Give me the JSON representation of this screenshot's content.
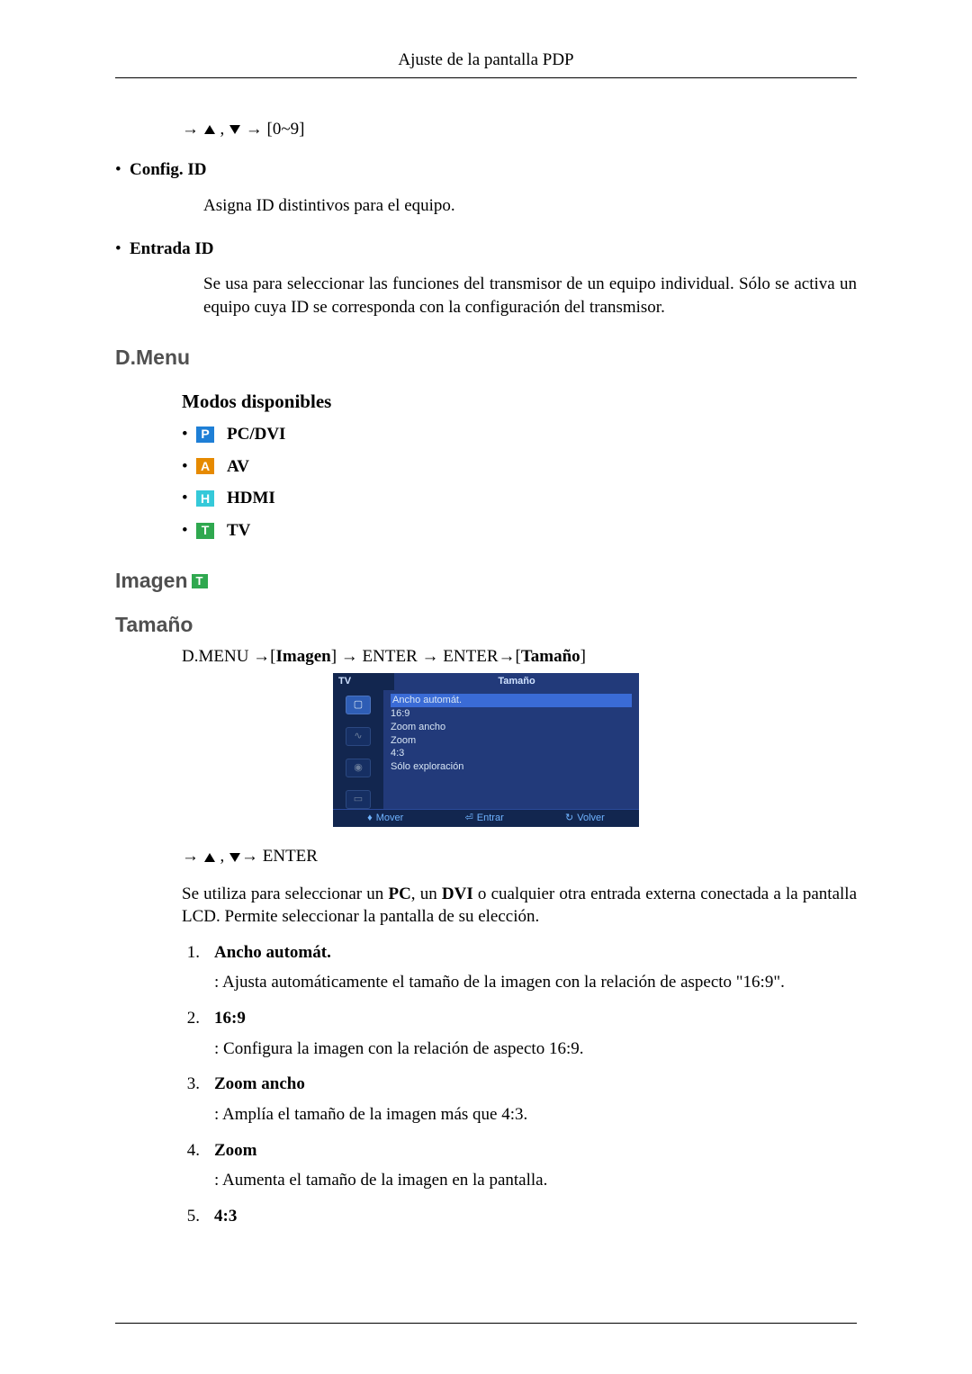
{
  "header": {
    "title": "Ajuste de la pantalla PDP"
  },
  "nav_line": {
    "range": "[0~9]"
  },
  "config_id": {
    "label": "Config. ID",
    "desc": "Asigna ID distintivos para el equipo."
  },
  "entrada_id": {
    "label": "Entrada ID",
    "desc": "Se usa para seleccionar las funciones del transmisor de un equipo individual. Sólo se activa un equipo cuya ID se corresponda con la configuración del transmisor."
  },
  "h2_dmenu": "D.Menu",
  "h3_modos": "Modos disponibles",
  "modes": {
    "pc": {
      "letter": "P",
      "label": "PC/DVI"
    },
    "av": {
      "letter": "A",
      "label": "AV"
    },
    "hdmi": {
      "letter": "H",
      "label": "HDMI"
    },
    "tv": {
      "letter": "T",
      "label": "TV"
    }
  },
  "h2_imagen": "Imagen",
  "imagen_badge": "T",
  "h2_tamano": "Tamaño",
  "path": {
    "pre": "D.MENU →[",
    "p1": "Imagen",
    "mid": "] → ENTER → ENTER→[",
    "p2": "Tamaño",
    "post": "]"
  },
  "osd": {
    "top_left": "TV",
    "top_right": "Tamaño",
    "items": {
      "i0": "Ancho automát.",
      "i1": "16:9",
      "i2": "Zoom ancho",
      "i3": "Zoom",
      "i4": "4:3",
      "i5": "Sólo exploración"
    },
    "footer": {
      "mover": "Mover",
      "entrar": "Entrar",
      "volver": "Volver"
    }
  },
  "enter_line": "ENTER",
  "intro_desc": "Se utiliza para seleccionar un ",
  "intro_pc": "PC",
  "intro_mid": ", un ",
  "intro_dvi": "DVI",
  "intro_rest": " o cualquier otra entrada externa conectada a la pantalla LCD. Permite seleccionar la pantalla de su elección.",
  "list": {
    "n1": "1.",
    "t1": "Ancho automát.",
    "d1": ": Ajusta automáticamente el tamaño de la imagen con la relación de aspecto \"16:9\".",
    "n2": "2.",
    "t2": "16:9",
    "d2": ": Configura la imagen con la relación de aspecto 16:9.",
    "n3": "3.",
    "t3": "Zoom ancho",
    "d3": ": Amplía el tamaño de la imagen más que 4:3.",
    "n4": "4.",
    "t4": "Zoom",
    "d4": ": Aumenta el tamaño de la imagen en la pantalla.",
    "n5": "5.",
    "t5": "4:3"
  }
}
